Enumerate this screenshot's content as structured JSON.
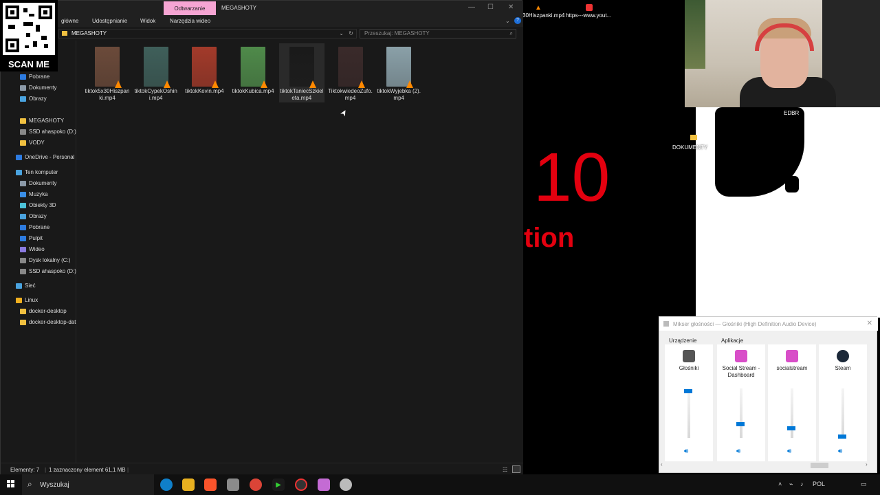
{
  "explorer": {
    "tab_label": "Odtwarzanie",
    "window_title": "MEGASHOTY",
    "ribbon": [
      "główne",
      "Udostępnianie",
      "Widok",
      "Narzędzia wideo"
    ],
    "address": "MEGASHOTY",
    "search_placeholder": "Przeszukaj: MEGASHOTY",
    "nav": [
      {
        "label": "Pobrane",
        "icon": "download-icon"
      },
      {
        "label": "Dokumenty",
        "icon": "documents-icon"
      },
      {
        "label": "Obrazy",
        "icon": "pictures-icon"
      },
      {
        "label": "MEGASHOTY",
        "icon": "folder-icon"
      },
      {
        "label": "SSD ahaspoko (D:)",
        "icon": "drive-icon"
      },
      {
        "label": "VODY",
        "icon": "folder-icon"
      },
      {
        "label": "OneDrive - Personal",
        "icon": "onedrive-icon"
      },
      {
        "label": "Ten komputer",
        "icon": "computer-icon"
      },
      {
        "label": "Dokumenty",
        "icon": "documents-icon"
      },
      {
        "label": "Muzyka",
        "icon": "music-icon"
      },
      {
        "label": "Obiekty 3D",
        "icon": "objects3d-icon"
      },
      {
        "label": "Obrazy",
        "icon": "pictures-icon"
      },
      {
        "label": "Pobrane",
        "icon": "download-icon"
      },
      {
        "label": "Pulpit",
        "icon": "desktop-icon"
      },
      {
        "label": "Wideo",
        "icon": "video-icon"
      },
      {
        "label": "Dysk lokalny (C:)",
        "icon": "drive-icon"
      },
      {
        "label": "SSD ahaspoko (D:)",
        "icon": "drive-icon"
      },
      {
        "label": "Sieć",
        "icon": "network-icon"
      },
      {
        "label": "Linux",
        "icon": "linux-icon"
      },
      {
        "label": "docker-desktop",
        "icon": "folder-icon"
      },
      {
        "label": "docker-desktop-dat",
        "icon": "folder-icon"
      }
    ],
    "files": [
      {
        "name": "tiktok5x30Hiszpanki.mp4",
        "color": "#6b4a3a"
      },
      {
        "name": "tiktokCypekOshini.mp4",
        "color": "#3f5f5a"
      },
      {
        "name": "tiktokKevin.mp4",
        "color": "#a23a2a"
      },
      {
        "name": "tiktokKubica.mp4",
        "color": "#4f8a4a"
      },
      {
        "name": "tiktokTaniecSzkieleta.mp4",
        "color": "#1a1a1a"
      },
      {
        "name": "TiktokwiedeoZufo.mp4",
        "color": "#3a2a2a"
      },
      {
        "name": "tiktokWyjebka (2).mp4",
        "color": "#8aa0a8"
      }
    ],
    "status_count": "Elementy: 7",
    "status_selected": "1 zaznaczony element 61,1 MB"
  },
  "desktop": {
    "top_items": [
      "30Hiszpanki.mp4",
      "https---www.yout..."
    ],
    "big_text_1": "10",
    "big_text_2": "tion",
    "icons": [
      "EDBR",
      "DOKUMENTY"
    ]
  },
  "qr": {
    "label": "SCAN ME"
  },
  "mixer": {
    "title": "Mikser głośności — Głośniki (High Definition Audio Device)",
    "device_header": "Urządzenie",
    "apps_header": "Aplikacje",
    "channels": [
      {
        "label": "Głośniki",
        "level": 0.95,
        "icon": "speaker-icon"
      },
      {
        "label": "Social Stream - Dashboard",
        "level": 0.28,
        "icon": "chat-icon"
      },
      {
        "label": "socialstream",
        "level": 0.19,
        "icon": "chat-icon"
      },
      {
        "label": "Steam",
        "level": 0.03,
        "icon": "steam-icon"
      }
    ]
  },
  "taskbar": {
    "search": "Wyszukaj",
    "lang": "POL"
  }
}
